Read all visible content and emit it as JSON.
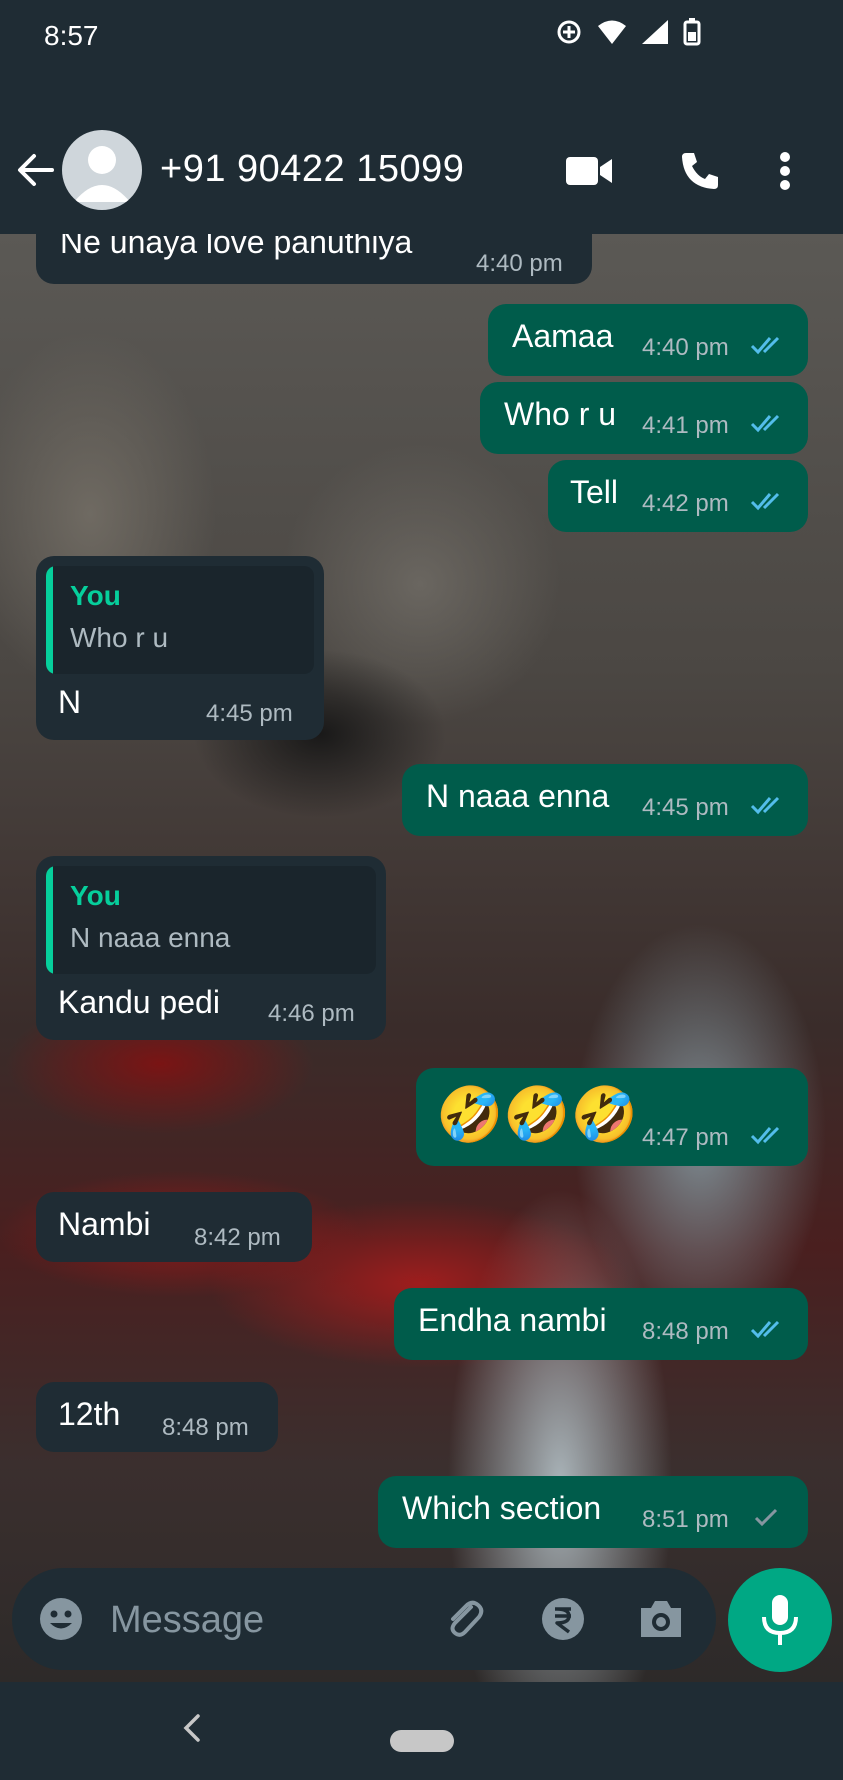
{
  "status": {
    "time": "8:57"
  },
  "header": {
    "contact": "+91 90422 15099"
  },
  "colors": {
    "incoming": "#1f2c34",
    "outgoing": "#005c4b",
    "accent": "#06cf9c",
    "read_tick": "#53bdeb",
    "sent_tick": "#8696a0"
  },
  "messages": [
    {
      "dir": "in",
      "text": "Ne unaya love panuthiya",
      "time": "4:40 pm"
    },
    {
      "dir": "out",
      "text": "Aamaa",
      "time": "4:40 pm",
      "status": "read"
    },
    {
      "dir": "out",
      "text": "Who r u",
      "time": "4:41 pm",
      "status": "read"
    },
    {
      "dir": "out",
      "text": "Tell",
      "time": "4:42 pm",
      "status": "read"
    },
    {
      "dir": "in",
      "quote_author": "You",
      "quote_text": "Who r u",
      "text": "N",
      "time": "4:45 pm"
    },
    {
      "dir": "out",
      "text": "N naaa enna",
      "time": "4:45 pm",
      "status": "read"
    },
    {
      "dir": "in",
      "quote_author": "You",
      "quote_text": "N naaa enna",
      "text": "Kandu pedi",
      "time": "4:46 pm"
    },
    {
      "dir": "out",
      "text": "🤣🤣🤣",
      "time": "4:47 pm",
      "status": "read"
    },
    {
      "dir": "in",
      "text": "Nambi",
      "time": "8:42 pm"
    },
    {
      "dir": "out",
      "text": "Endha nambi",
      "time": "8:48 pm",
      "status": "read"
    },
    {
      "dir": "in",
      "text": "12th",
      "time": "8:48 pm"
    },
    {
      "dir": "out",
      "text": "Which section",
      "time": "8:51 pm",
      "status": "sent"
    }
  ],
  "composer": {
    "placeholder": "Message"
  },
  "icons": [
    "back-arrow-icon",
    "avatar-icon",
    "video-call-icon",
    "phone-icon",
    "more-options-icon",
    "emoji-icon",
    "attach-icon",
    "rupee-icon",
    "camera-icon",
    "mic-icon"
  ]
}
